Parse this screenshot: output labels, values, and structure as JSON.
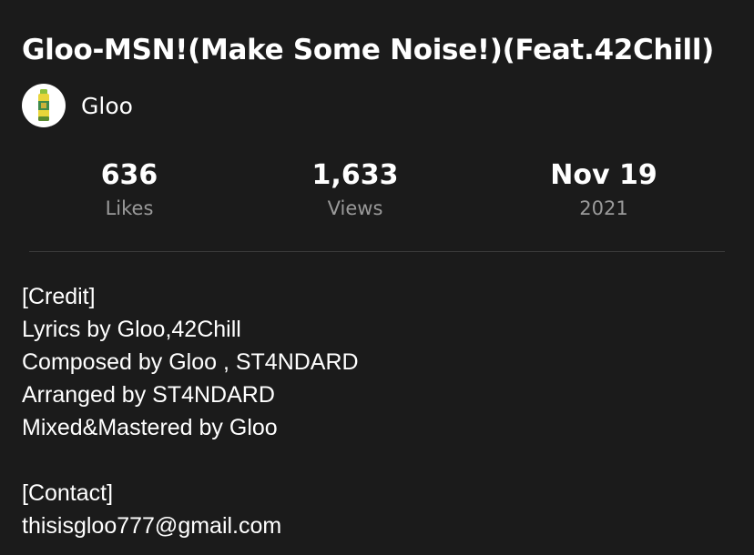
{
  "video": {
    "title": "Gloo-MSN!(Make Some Noise!)(Feat.42Chill)"
  },
  "channel": {
    "name": "Gloo",
    "avatar_icon": "glue-stick-icon"
  },
  "stats": [
    {
      "value": "636",
      "label": "Likes"
    },
    {
      "value": "1,633",
      "label": "Views"
    },
    {
      "value": "Nov 19",
      "label": "2021"
    }
  ],
  "description": {
    "lines": [
      "[Credit]",
      "Lyrics by Gloo,42Chill",
      "Composed by Gloo , ST4NDARD",
      "Arranged by ST4NDARD",
      "Mixed&Mastered by Gloo",
      "",
      "[Contact]",
      "thisisgloo777@gmail.com"
    ]
  },
  "colors": {
    "background": "#1b1b1b",
    "text": "#ffffff",
    "secondary_text": "#9a9a9a",
    "divider": "#3a3a3a"
  }
}
